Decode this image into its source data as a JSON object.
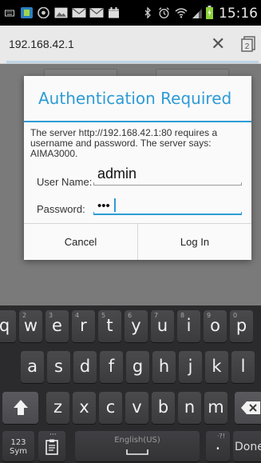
{
  "status_bar": {
    "time": "15:16",
    "icons": [
      "keyboard-icon",
      "app-icon",
      "chrome-icon",
      "image-icon",
      "mail-icon",
      "mail-icon",
      "calendar-icon",
      "bluetooth-icon",
      "alarm-icon",
      "wifi-icon",
      "signal-icon",
      "battery-icon"
    ]
  },
  "url_bar": {
    "url": "192.168.42.1",
    "close_icon": "close-icon",
    "tabs_icon": "tabs-icon",
    "tabs_count": "2"
  },
  "dialog": {
    "title": "Authentication Required",
    "message": "The server http://192.168.42.1:80 requires a username and password. The server says: AIMA3000.",
    "username_label": "User Name:",
    "username_value": "admin",
    "password_label": "Password:",
    "password_value": "•••",
    "cancel_label": "Cancel",
    "login_label": "Log In",
    "accent_color": "#2e9bd6"
  },
  "keyboard": {
    "row1": [
      {
        "ch": "q",
        "num": "1"
      },
      {
        "ch": "w",
        "num": "2"
      },
      {
        "ch": "e",
        "num": "3"
      },
      {
        "ch": "r",
        "num": "4"
      },
      {
        "ch": "t",
        "num": "5"
      },
      {
        "ch": "y",
        "num": "6"
      },
      {
        "ch": "u",
        "num": "7"
      },
      {
        "ch": "i",
        "num": "8"
      },
      {
        "ch": "o",
        "num": "9"
      },
      {
        "ch": "p",
        "num": "0"
      }
    ],
    "row2": [
      "a",
      "s",
      "d",
      "f",
      "g",
      "h",
      "j",
      "k",
      "l"
    ],
    "row3": [
      "z",
      "x",
      "c",
      "v",
      "b",
      "n",
      "m"
    ],
    "sym_top": "123",
    "sym_bottom": "Sym",
    "space_label": "English(US)",
    "period": ".",
    "period_extra": "·?!",
    "clipboard_extra": "···",
    "done_label": "Done",
    "shift_icon": "shift-icon",
    "backspace_icon": "backspace-icon",
    "clipboard_icon": "clipboard-icon"
  }
}
